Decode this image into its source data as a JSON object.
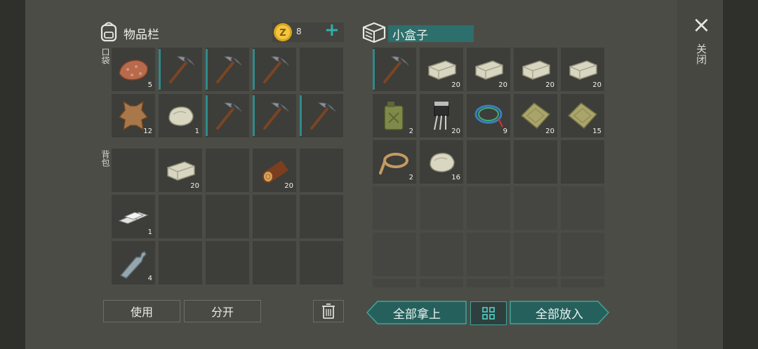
{
  "left_panel": {
    "title": "物品栏",
    "coin_count": "8",
    "plus_label": "+",
    "pocket_label": "口袋",
    "backpack_label": "背包"
  },
  "right_panel": {
    "container_name": "小盒子"
  },
  "close": {
    "label": "关闭",
    "icon": "×"
  },
  "pocket_slots": [
    {
      "item": "copper-ore",
      "count": "5"
    },
    {
      "item": "pickaxe",
      "count": ""
    },
    {
      "item": "pickaxe",
      "count": ""
    },
    {
      "item": "pickaxe",
      "count": ""
    },
    {
      "item": "",
      "count": ""
    },
    {
      "item": "leather",
      "count": "12"
    },
    {
      "item": "stone",
      "count": "1"
    },
    {
      "item": "pickaxe",
      "count": ""
    },
    {
      "item": "pickaxe",
      "count": ""
    },
    {
      "item": "pickaxe",
      "count": ""
    }
  ],
  "backpack_slots": [
    {
      "item": "",
      "count": ""
    },
    {
      "item": "stone-block",
      "count": "20"
    },
    {
      "item": "",
      "count": ""
    },
    {
      "item": "log",
      "count": "20"
    },
    {
      "item": "",
      "count": ""
    },
    {
      "item": "iron-bars",
      "count": "1"
    },
    {
      "item": "",
      "count": ""
    },
    {
      "item": "",
      "count": ""
    },
    {
      "item": "",
      "count": ""
    },
    {
      "item": "",
      "count": ""
    },
    {
      "item": "bottle",
      "count": "4"
    },
    {
      "item": "",
      "count": ""
    },
    {
      "item": "",
      "count": ""
    },
    {
      "item": "",
      "count": ""
    },
    {
      "item": "",
      "count": ""
    }
  ],
  "box_slots": [
    {
      "item": "pickaxe",
      "count": ""
    },
    {
      "item": "stone-block",
      "count": "20"
    },
    {
      "item": "stone-block",
      "count": "20"
    },
    {
      "item": "stone-block",
      "count": "20"
    },
    {
      "item": "stone-block",
      "count": "20"
    },
    {
      "item": "jerrycan",
      "count": "2"
    },
    {
      "item": "transistor",
      "count": "20"
    },
    {
      "item": "wire",
      "count": "9"
    },
    {
      "item": "cloth",
      "count": "20"
    },
    {
      "item": "cloth",
      "count": "15"
    },
    {
      "item": "rope",
      "count": "2"
    },
    {
      "item": "stone",
      "count": "16"
    },
    {
      "item": "",
      "count": ""
    },
    {
      "item": "",
      "count": ""
    },
    {
      "item": "",
      "count": ""
    }
  ],
  "buttons": {
    "use": "使用",
    "split": "分开",
    "take_all": "全部拿上",
    "put_all": "全部放入"
  }
}
